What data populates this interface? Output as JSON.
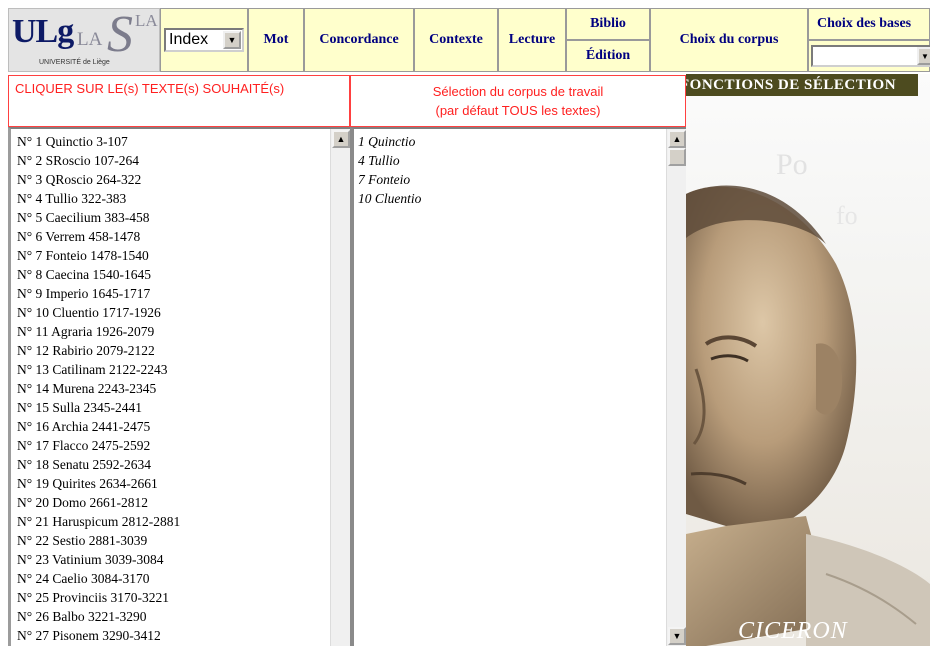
{
  "logo": {
    "main": "ULg",
    "secondary": "LA",
    "s": "S",
    "tertiary": "LA",
    "university": "UNIVERSITÉ de Liège"
  },
  "menu": {
    "index_value": "Index",
    "mot": "Mot",
    "concordance": "Concordance",
    "contexte": "Contexte",
    "lecture": "Lecture",
    "biblio": "Biblio",
    "edition": "Édition",
    "choix_corpus": "Choix du corpus",
    "choix_bases": "Choix des bases"
  },
  "left_panel": {
    "header": "CLIQUER SUR LE(s) TEXTE(s) SOUHAITÉ(s)",
    "items": [
      "N° 1 Quinctio 3-107",
      "N° 2 SRoscio 107-264",
      "N° 3 QRoscio 264-322",
      "N° 4 Tullio 322-383",
      "N° 5 Caecilium 383-458",
      "N° 6 Verrem 458-1478",
      "N° 7 Fonteio 1478-1540",
      "N° 8 Caecina 1540-1645",
      "N° 9 Imperio 1645-1717",
      "N° 10 Cluentio 1717-1926",
      "N° 11 Agraria 1926-2079",
      "N° 12 Rabirio 2079-2122",
      "N° 13 Catilinam 2122-2243",
      "N° 14 Murena 2243-2345",
      "N° 15 Sulla 2345-2441",
      "N° 16 Archia 2441-2475",
      "N° 17 Flacco 2475-2592",
      "N° 18 Senatu 2592-2634",
      "N° 19 Quirites 2634-2661",
      "N° 20 Domo  2661-2812",
      "N° 21 Haruspicum 2812-2881",
      "N° 22 Sestio 2881-3039",
      "N° 23 Vatinium 3039-3084",
      "N° 24 Caelio 3084-3170",
      "N° 25 Provinciis 3170-3221",
      "N° 26 Balbo 3221-3290",
      "N° 27 Pisonem 3290-3412"
    ]
  },
  "right_panel": {
    "header_line1": "Sélection du corpus de travail",
    "header_line2": "(par défaut TOUS les textes)",
    "items": [
      "1 Quinctio",
      "4 Tullio",
      "7 Fonteio",
      "10 Cluentio"
    ]
  },
  "portrait": {
    "banner": "FONCTIONS  DE  SÉLECTION",
    "name": "CICERON"
  },
  "icons": {
    "dropdown": "chevron-down-icon",
    "scroll_up": "arrow-up-icon",
    "scroll_down": "arrow-down-icon"
  }
}
